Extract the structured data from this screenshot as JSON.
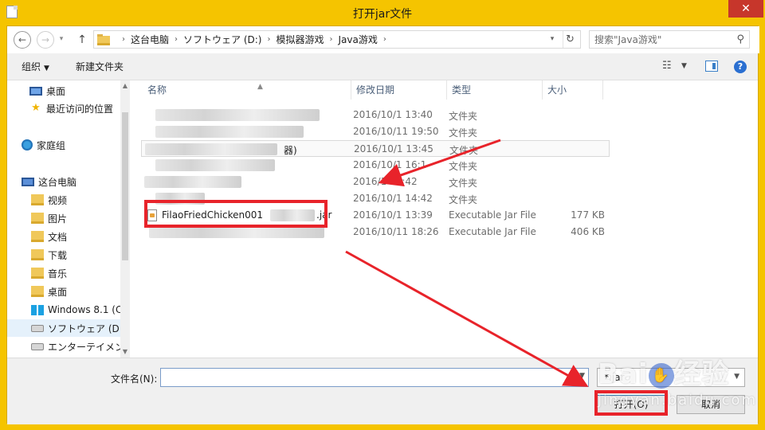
{
  "window": {
    "title": "打开jar文件",
    "close_glyph": "✕"
  },
  "address_bar": {
    "back_glyph": "←",
    "forward_glyph": "→",
    "recent_glyph": "▾",
    "up_glyph": "↑",
    "breadcrumb": [
      "这台电脑",
      "ソフトウェア (D:)",
      "模拟器游戏",
      "Java游戏"
    ],
    "separator_glyph": "›",
    "dropdown_glyph": "▾",
    "refresh_glyph": "↻"
  },
  "search": {
    "placeholder": "搜索\"Java游戏\"",
    "icon": "search-icon",
    "icon_glyph": "⚲"
  },
  "toolbar": {
    "organize_label": "组织",
    "organize_dd": "▼",
    "new_folder_label": "新建文件夹",
    "view_glyph": "☷",
    "view_dd": "▼",
    "help_glyph": "?"
  },
  "nav": {
    "items": [
      {
        "label": "桌面",
        "icon": "monitor-icon"
      },
      {
        "label": "最近访问的位置",
        "icon": "star-icon",
        "glyph": "★"
      },
      {
        "label": "家庭组",
        "icon": "homegroup-icon"
      },
      {
        "label": "这台电脑",
        "icon": "pc-icon"
      },
      {
        "label": "视频",
        "icon": "folder-icon"
      },
      {
        "label": "图片",
        "icon": "folder-icon"
      },
      {
        "label": "文档",
        "icon": "folder-icon"
      },
      {
        "label": "下载",
        "icon": "folder-icon"
      },
      {
        "label": "音乐",
        "icon": "folder-icon"
      },
      {
        "label": "桌面",
        "icon": "folder-icon"
      },
      {
        "label": "Windows 8.1 (C",
        "icon": "windows-drive-icon"
      },
      {
        "label": "ソフトウェア (D",
        "icon": "drive-icon"
      },
      {
        "label": "エンターテイメン",
        "icon": "drive-icon"
      }
    ],
    "scroll_up_glyph": "▲",
    "scroll_down_glyph": "▼"
  },
  "columns": {
    "name": "名称",
    "date": "修改日期",
    "type": "类型",
    "size": "大小",
    "sort_glyph": "▲"
  },
  "files": [
    {
      "name": "",
      "date": "2016/10/1 13:40",
      "type": "文件夹",
      "size": ""
    },
    {
      "name": "",
      "date": "2016/10/11 19:50",
      "type": "文件夹",
      "size": ""
    },
    {
      "name": "器)",
      "date": "2016/10/1 13:45",
      "type": "文件夹",
      "size": ""
    },
    {
      "name": "",
      "date": "2016/10/1 16:1",
      "type": "文件夹",
      "size": ""
    },
    {
      "name": "",
      "date": "2016/1 13:42",
      "type": "文件夹",
      "size": ""
    },
    {
      "name": "",
      "date": "2016/10/1 14:42",
      "type": "文件夹",
      "size": ""
    },
    {
      "name": "FilaoFriedChicken001",
      "name_suffix": ".jar",
      "date": "2016/10/1 13:39",
      "type": "Executable Jar File",
      "size": "177 KB"
    },
    {
      "name": "",
      "date": "2016/10/11 18:26",
      "type": "Executable Jar File",
      "size": "406 KB"
    }
  ],
  "bottom": {
    "filename_label": "文件名(N):",
    "filename_value": "",
    "filter_value": "*.jar",
    "dropdown_glyph": "▼",
    "open_label": "打开(O)",
    "cancel_label": "取消"
  },
  "watermark": {
    "brand_left": "Bai",
    "paw_glyph": "✋",
    "brand_right": "经验",
    "domain": "jingyan.baidu.com"
  },
  "colors": {
    "title_bar": "#f5c400",
    "highlight": "#e8232a"
  }
}
